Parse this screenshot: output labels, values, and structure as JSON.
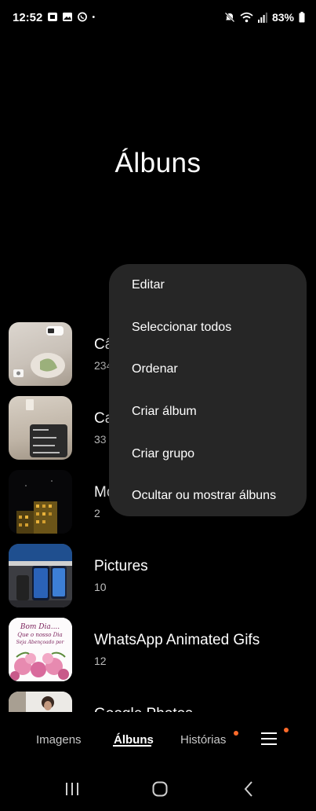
{
  "status_bar": {
    "time": "12:52",
    "battery": "83%",
    "left_icons": [
      "sim-card-icon",
      "image-icon",
      "whatsapp-icon",
      "dot-icon"
    ],
    "right_icons": [
      "mute-icon",
      "wifi-icon",
      "signal-icon",
      "battery-icon"
    ]
  },
  "page": {
    "title": "Álbuns"
  },
  "albums": [
    {
      "name": "Câmara",
      "count": "234",
      "visible_name": "Câ",
      "visible_count": "234"
    },
    {
      "name": "Capturas de ecrã",
      "count": "33",
      "visible_name": "Ca",
      "visible_count": "33"
    },
    {
      "name": "Movies",
      "count": "2",
      "visible_name": "Mo",
      "visible_count": "2"
    },
    {
      "name": "Pictures",
      "count": "10",
      "visible_name": "Pictures",
      "visible_count": "10"
    },
    {
      "name": "WhatsApp Animated Gifs",
      "count": "12",
      "visible_name": "WhatsApp Animated Gifs",
      "visible_count": "12"
    },
    {
      "name": "Google Photos",
      "count": "",
      "visible_name": "Google Photos",
      "visible_count": ""
    }
  ],
  "context_menu": {
    "items": [
      "Editar",
      "Seleccionar todos",
      "Ordenar",
      "Criar álbum",
      "Criar grupo",
      "Ocultar ou mostrar álbuns"
    ]
  },
  "bottom_nav": {
    "tabs": [
      "Imagens",
      "Álbuns",
      "Histórias"
    ],
    "active_tab": "Álbuns",
    "badge_color": "#ff6a2a"
  },
  "thumb_texts": {
    "whatsapp_gif_line1": "Bom Dia....",
    "whatsapp_gif_line2": "Que o nosso Dia",
    "whatsapp_gif_line3": "Seja Abençoado por"
  }
}
